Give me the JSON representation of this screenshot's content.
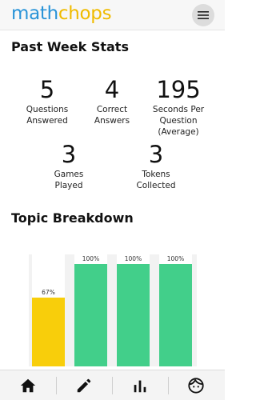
{
  "header": {
    "logo_part1": "math",
    "logo_part2": "chops",
    "menu_icon": "hamburger-icon"
  },
  "stats_section": {
    "title": "Past Week Stats",
    "stats": [
      {
        "value": "5",
        "label_line1": "Questions",
        "label_line2": "Answered",
        "label_line3": ""
      },
      {
        "value": "4",
        "label_line1": "Correct",
        "label_line2": "Answers",
        "label_line3": ""
      },
      {
        "value": "195",
        "label_line1": "Seconds Per",
        "label_line2": "Question",
        "label_line3": "(Average)"
      },
      {
        "value": "3",
        "label_line1": "Games",
        "label_line2": "Played",
        "label_line3": ""
      },
      {
        "value": "3",
        "label_line1": "Tokens",
        "label_line2": "Collected",
        "label_line3": ""
      }
    ]
  },
  "topic_section": {
    "title": "Topic Breakdown"
  },
  "chart_data": {
    "type": "bar",
    "categories": [
      "",
      "",
      "",
      ""
    ],
    "values": [
      67,
      100,
      100,
      100
    ],
    "value_labels": [
      "67%",
      "100%",
      "100%",
      "100%"
    ],
    "colors": [
      "#f8ce0b",
      "#42cf8a",
      "#42cf8a",
      "#42cf8a"
    ],
    "ylim": [
      0,
      100
    ]
  },
  "tabbar": {
    "tabs": [
      {
        "icon": "home-icon"
      },
      {
        "icon": "pencil-icon"
      },
      {
        "icon": "bar-chart-icon"
      },
      {
        "icon": "face-icon"
      }
    ]
  },
  "colors": {
    "logo_blue": "#2a94d8",
    "logo_yellow": "#f0bb00",
    "bar_green": "#42cf8a",
    "bar_yellow": "#f8ce0b"
  }
}
